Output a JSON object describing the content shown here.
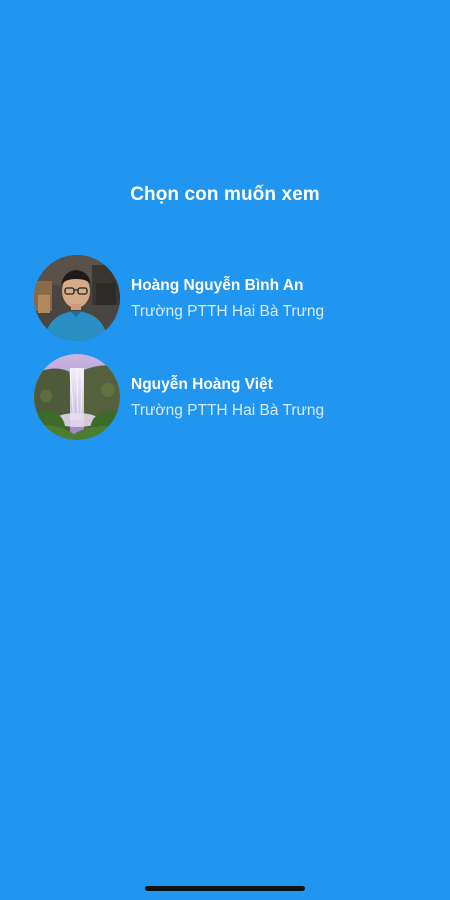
{
  "header": {
    "title": "Chọn con muốn xem"
  },
  "children": [
    {
      "name": "Hoàng Nguyễn Bình An",
      "school": "Trường PTTH Hai Bà Trưng",
      "avatar_icon": "child-photo-avatar"
    },
    {
      "name": "Nguyễn Hoàng Việt",
      "school": "Trường PTTH Hai Bà Trưng",
      "avatar_icon": "waterfall-landscape-avatar"
    }
  ],
  "colors": {
    "background": "#2196F0",
    "text_primary": "#FFFFFF",
    "home_indicator": "#111111"
  }
}
